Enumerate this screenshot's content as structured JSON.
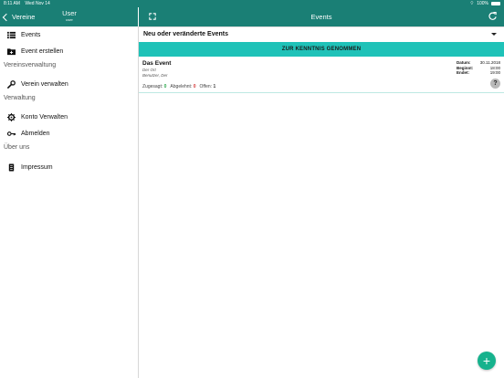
{
  "status_bar": {
    "time": "8:11 AM",
    "date": "Wed Nov 14",
    "battery": "100%"
  },
  "sidebar_header": {
    "back_label": "Vereine",
    "user_name": "User",
    "user_sub": "user"
  },
  "main_header": {
    "title": "Events"
  },
  "nav": {
    "events": "Events",
    "event_create": "Event erstellen",
    "section_club": "Vereinsverwaltung",
    "club_manage": "Verein verwalten",
    "section_admin": "Verwaltung",
    "account_manage": "Konto Verwalten",
    "logout": "Abmelden",
    "section_about": "Über uns",
    "imprint": "Impressum"
  },
  "filter": {
    "selected": "Neu oder veränderte Events"
  },
  "ack_button": "ZUR KENNTNIS GENOMMEN",
  "event": {
    "title": "Das Event",
    "location": "Der Ort",
    "author": "Benutzer, Der",
    "datum_label": "Datum:",
    "datum": "30.11.2018",
    "beginnt_label": "Beginnt:",
    "beginnt": "18:00",
    "endet_label": "Endet:",
    "endet": "19:00",
    "accepted_label": "Zugesagt:",
    "accepted": "0",
    "declined_label": "Abgelehnt:",
    "declined": "0",
    "open_label": "Offen:",
    "open": "1",
    "help": "?"
  },
  "fab": "+",
  "colors": {
    "header": "#1a7f75",
    "ack_bar": "#1fc2b8",
    "fab": "#16b28d"
  }
}
